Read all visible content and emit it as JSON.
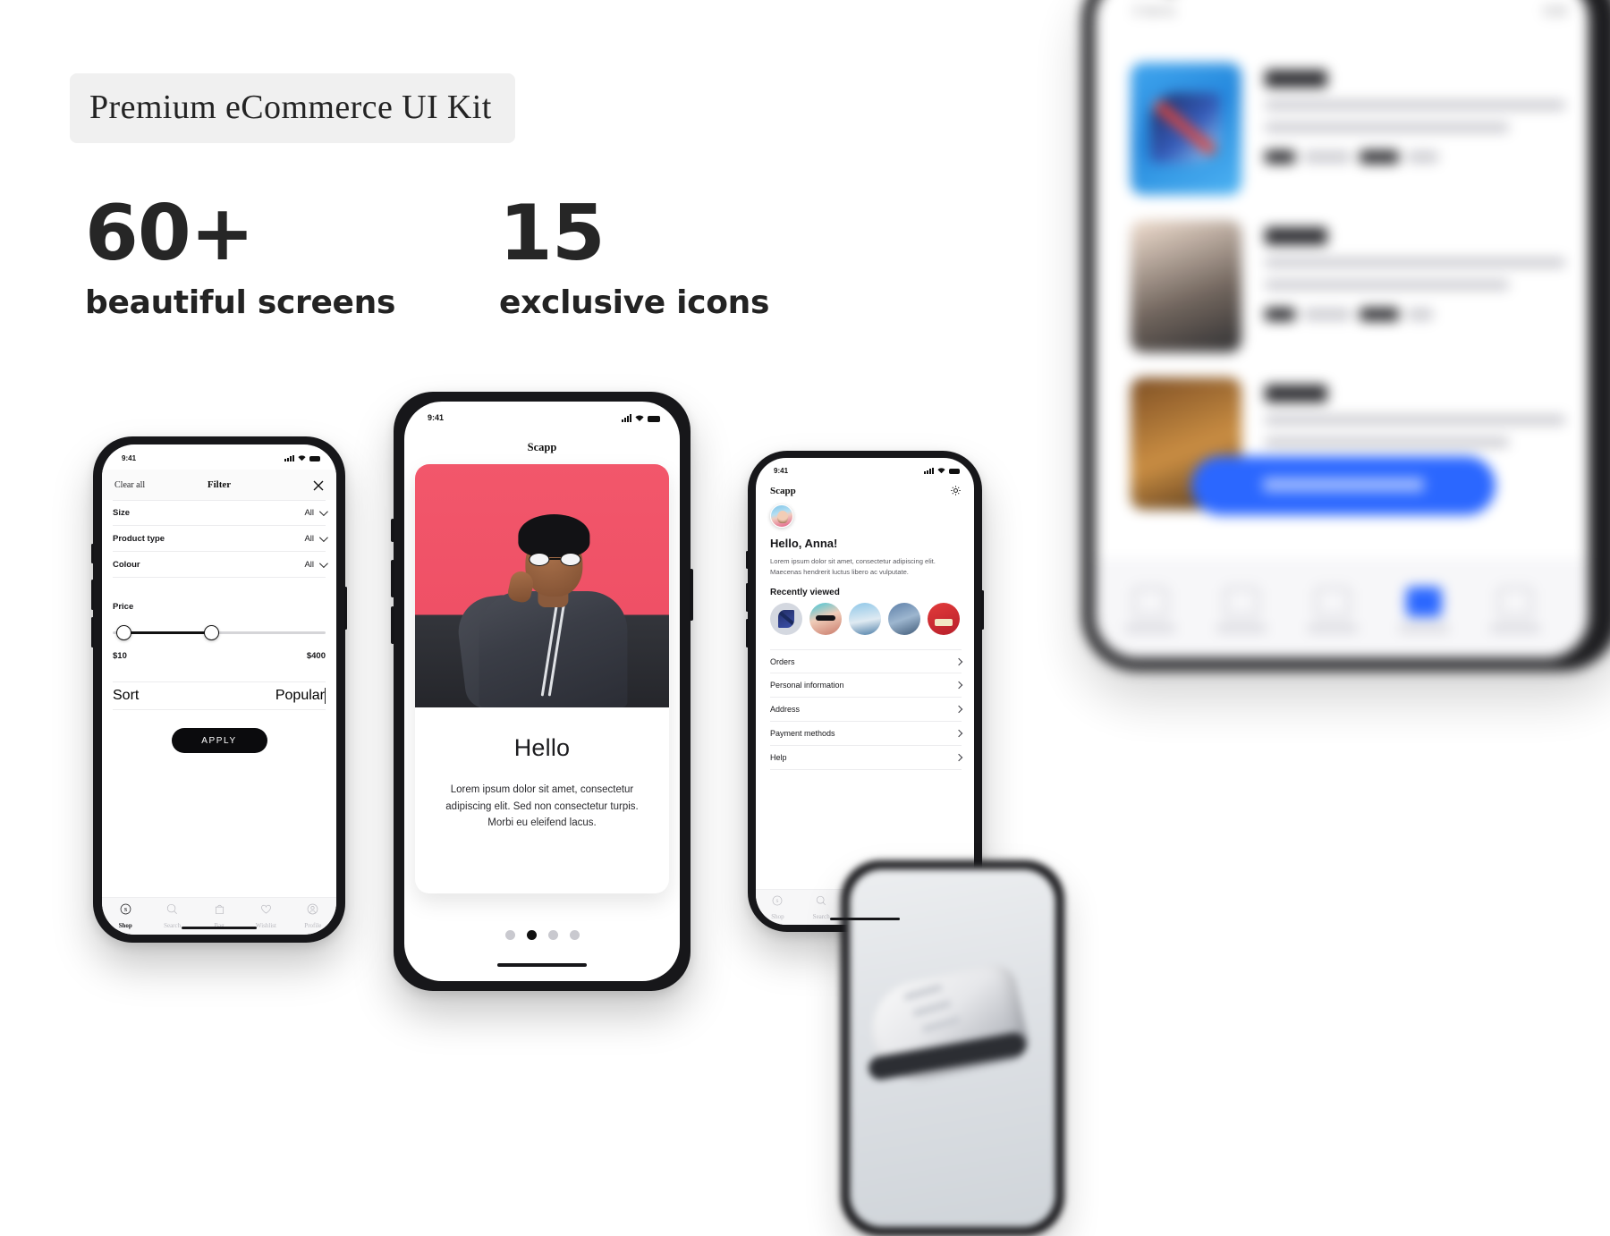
{
  "hero": {
    "badge": "Premium eCommerce UI Kit",
    "stats": [
      {
        "number": "60+",
        "caption": "beautiful screens"
      },
      {
        "number": "15",
        "caption": "exclusive icons"
      }
    ]
  },
  "colors": {
    "accent_red": "#ef5066",
    "accent_blue": "#2563ff",
    "text_dark": "#17171a",
    "badge_bg": "#f0f0f0",
    "tabbar_bg": "#f7f7f8",
    "inactive": "#b9b9bf"
  },
  "tabbar": {
    "items": [
      {
        "label": "Shop",
        "icon": "shop-s-circle-icon"
      },
      {
        "label": "Search",
        "icon": "search-icon"
      },
      {
        "label": "Bag",
        "icon": "bag-icon"
      },
      {
        "label": "Wishlist",
        "icon": "heart-icon"
      },
      {
        "label": "Profile",
        "icon": "person-icon"
      }
    ],
    "active_filter_screen": "Shop",
    "active_profile_screen": "Profile"
  },
  "filter_screen": {
    "status_time": "9:41",
    "clear_all": "Clear all",
    "title": "Filter",
    "close_icon": "close-icon",
    "rows": [
      {
        "label": "Size",
        "value": "All"
      },
      {
        "label": "Product type",
        "value": "All"
      },
      {
        "label": "Colour",
        "value": "All"
      }
    ],
    "price": {
      "label": "Price",
      "min": "$10",
      "max": "$400",
      "handle_low_pct": 4,
      "handle_high_pct": 45
    },
    "sort": {
      "label": "Sort",
      "value": "Popular"
    },
    "apply": "APPLY"
  },
  "hello_screen": {
    "status_time": "9:41",
    "brand": "Scapp",
    "title": "Hello",
    "body": "Lorem ipsum dolor sit amet, consectetur adipiscing elit. Sed non consectetur turpis. Morbi eu eleifend lacus.",
    "pagination": {
      "total": 4,
      "active_index": 1
    }
  },
  "profile_screen": {
    "status_time": "9:41",
    "brand": "Scapp",
    "settings_icon": "gear-icon",
    "avatar": "user-avatar",
    "greeting": "Hello, Anna!",
    "subtitle": "Lorem ipsum dolor sit amet, consectetur adipiscing elit. Maecenas hendrerit luctus libero ac vulputate.",
    "recently_viewed_title": "Recently viewed",
    "recently_viewed": [
      "heel-shoe-thumb",
      "sunglasses-woman-thumb",
      "denim-jacket-thumb",
      "jeans-thumb",
      "red-sweater-thumb"
    ],
    "menu": [
      "Orders",
      "Personal information",
      "Address",
      "Payment methods",
      "Help"
    ]
  },
  "background_phone": {
    "description": "blurred bag screen mockup",
    "cta": "checkout-button",
    "rows": 3
  },
  "bottom_phone": {
    "description": "blurred sneaker product screen"
  }
}
